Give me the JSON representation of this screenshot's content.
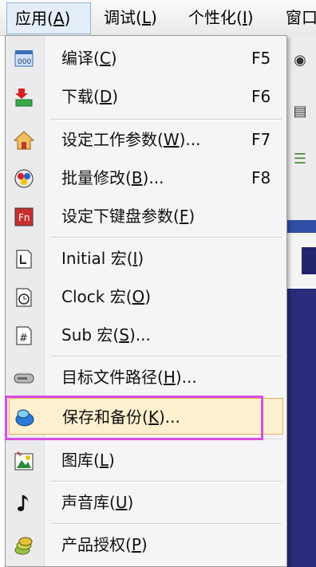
{
  "menubar": {
    "items": [
      {
        "label": "应用(",
        "key": "A",
        "tail": ")"
      },
      {
        "label": "调试(",
        "key": "L",
        "tail": ")"
      },
      {
        "label": "个性化(",
        "key": "I",
        "tail": ")"
      },
      {
        "label": "窗口"
      }
    ]
  },
  "menu": {
    "items": [
      {
        "label": "编译(",
        "key": "C",
        "tail": ")",
        "shortcut": "F5",
        "icon": "compile-icon"
      },
      {
        "label": "下载(",
        "key": "D",
        "tail": ")",
        "shortcut": "F6",
        "icon": "download-icon"
      },
      {
        "label": "设定工作参数(",
        "key": "W",
        "tail": ")...",
        "shortcut": "F7",
        "icon": "house-icon"
      },
      {
        "label": "批量修改(",
        "key": "B",
        "tail": ")...",
        "shortcut": "F8",
        "icon": "batch-edit-icon"
      },
      {
        "label": "设定下键盘参数(",
        "key": "F",
        "tail": ")",
        "shortcut": "",
        "icon": "function-key-icon"
      },
      {
        "label": "Initial 宏(",
        "key": "I",
        "tail": ")",
        "shortcut": "",
        "icon": "initial-macro-icon"
      },
      {
        "label": "Clock 宏(",
        "key": "O",
        "tail": ")",
        "shortcut": "",
        "icon": "clock-macro-icon"
      },
      {
        "label": "Sub 宏(",
        "key": "S",
        "tail": ")...",
        "shortcut": "",
        "icon": "sub-macro-icon"
      },
      {
        "label": "目标文件路径(",
        "key": "H",
        "tail": ")...",
        "shortcut": "",
        "icon": "drive-icon"
      },
      {
        "label": "保存和备份(",
        "key": "K",
        "tail": ")...",
        "shortcut": "",
        "icon": "save-backup-icon"
      },
      {
        "label": "图库(",
        "key": "L",
        "tail": ")",
        "shortcut": "",
        "icon": "gallery-icon"
      },
      {
        "label": "声音库(",
        "key": "U",
        "tail": ")",
        "shortcut": "",
        "icon": "music-note-icon"
      },
      {
        "label": "产品授权(",
        "key": "P",
        "tail": ")",
        "shortcut": "",
        "icon": "license-icon"
      }
    ]
  },
  "colors": {
    "highlight_border": "#d64fe0",
    "hover_fill": "#fdf0cf",
    "background_blue": "#2a2b7a"
  }
}
